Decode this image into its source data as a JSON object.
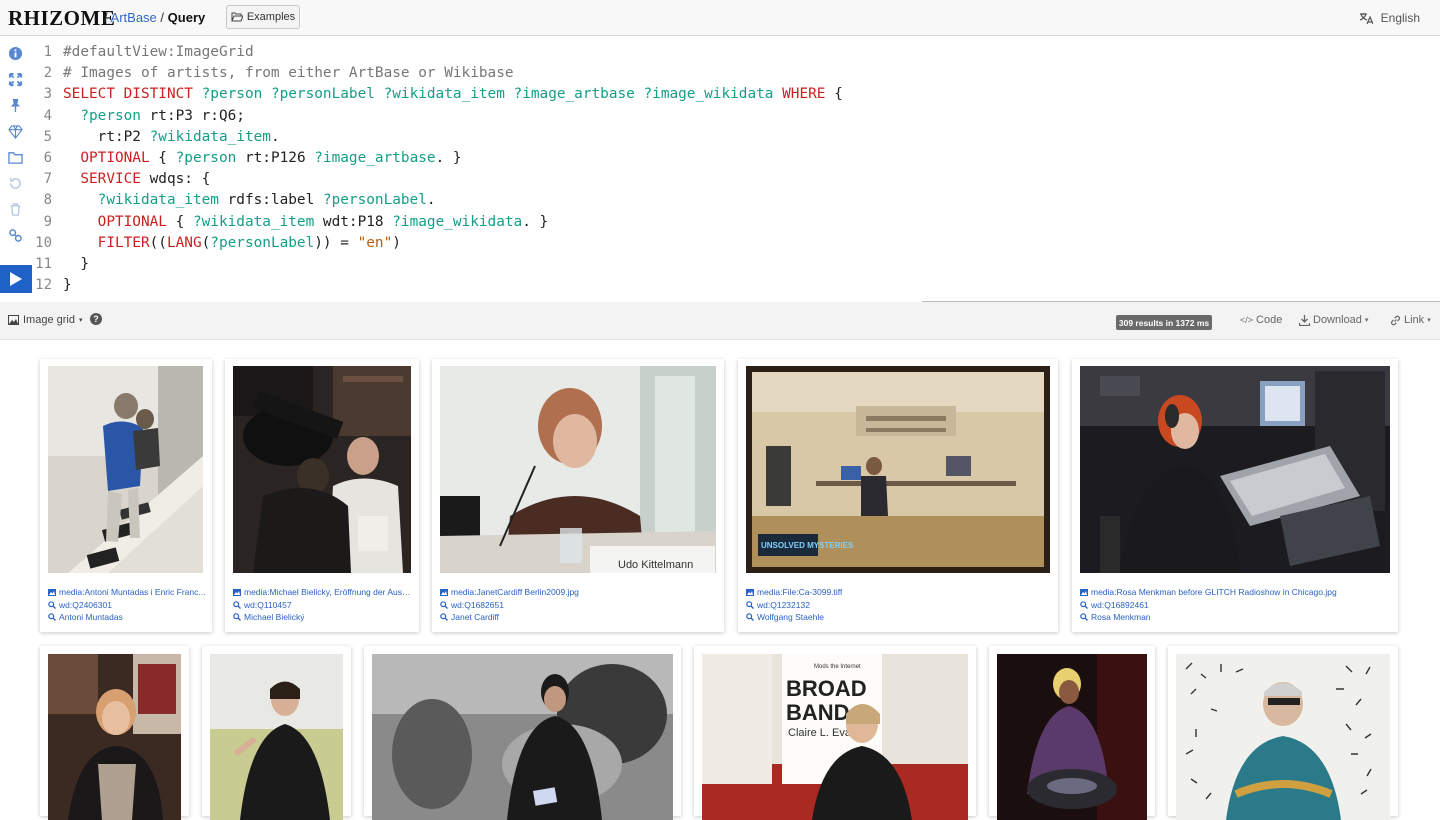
{
  "header": {
    "brand": "RHIZOME",
    "sep1": "/",
    "crumb_artbase": "ArtBase",
    "sep2": "/",
    "crumb_query": "Query",
    "examples_label": "Examples",
    "language": "English"
  },
  "editor": {
    "line_numbers": [
      "1",
      "2",
      "3",
      "4",
      "5",
      "6",
      "7",
      "8",
      "9",
      "10",
      "11",
      "12"
    ],
    "code": {
      "l1": "#defaultView:ImageGrid",
      "l2": "# Images of artists, from either ArtBase or Wikibase",
      "l3_kw": "SELECT DISTINCT",
      "l3_vars": " ?person ?personLabel ?wikidata_item ?image_artbase ?image_wikidata ",
      "l3_where": "WHERE",
      "l3_end": " {",
      "l4_var": "  ?person",
      "l4_rest": " rt:P3 r:Q6;",
      "l5_a": "    rt:P2 ",
      "l5_var": "?wikidata_item",
      "l5_end": ".",
      "l6_kw": "  OPTIONAL",
      "l6_a": " { ",
      "l6_var1": "?person",
      "l6_b": " rt:P126 ",
      "l6_var2": "?image_artbase",
      "l6_end": ". }",
      "l7_kw": "  SERVICE",
      "l7_rest": " wdqs: {",
      "l8_var1": "    ?wikidata_item",
      "l8_mid": " rdfs:label ",
      "l8_var2": "?personLabel",
      "l8_end": ".",
      "l9_kw": "    OPTIONAL",
      "l9_a": " { ",
      "l9_var1": "?wikidata_item",
      "l9_b": " wdt:P18 ",
      "l9_var2": "?image_wikidata",
      "l9_end": ". }",
      "l10_kw1": "    FILTER",
      "l10_a": "((",
      "l10_kw2": "LANG",
      "l10_b": "(",
      "l10_var": "?personLabel",
      "l10_c": ")) = ",
      "l10_str": "\"en\"",
      "l10_d": ")",
      "l11": "  }",
      "l12": "}"
    }
  },
  "results": {
    "view_label": "Image grid",
    "count_label": "309 results in 1372 ms",
    "code_label": "Code",
    "download_label": "Download",
    "link_label": "Link"
  },
  "cards": [
    {
      "media": "media:Antoni Muntadas i Enric Franc...",
      "wd": "wd:Q2406301",
      "name": "Antoni Muntadas"
    },
    {
      "media": "media:Michael Bielicky, Eröffnung der Auss...",
      "wd": "wd:Q110457",
      "name": "Michael Bielický"
    },
    {
      "media": "media:JanetCardiff Berlin2009.jpg",
      "wd": "wd:Q1682651",
      "name": "Janet Cardiff"
    },
    {
      "media": "media:File:Ca-3099.tiff",
      "wd": "wd:Q1232132",
      "name": "Wolfgang Staehle"
    },
    {
      "media": "media:Rosa Menkman before GLITCH Radioshow in Chicago.jpg",
      "wd": "wd:Q16892461",
      "name": "Rosa Menkman"
    }
  ],
  "photo_texts": {
    "nameplate": "Udo Kittelmann",
    "unsolved": "UNSOLVED MYSTERIES",
    "broadband_line1": "BROAD",
    "broadband_line2": "BAND",
    "broadband_author": "Claire L. Eva",
    "poster_top": "Mods the    Internet"
  },
  "colors": {
    "accent": "#1e62c8",
    "link": "#2a62c4",
    "keyword": "#cc1f1f",
    "variable": "#139e87",
    "string": "#b55e15"
  }
}
